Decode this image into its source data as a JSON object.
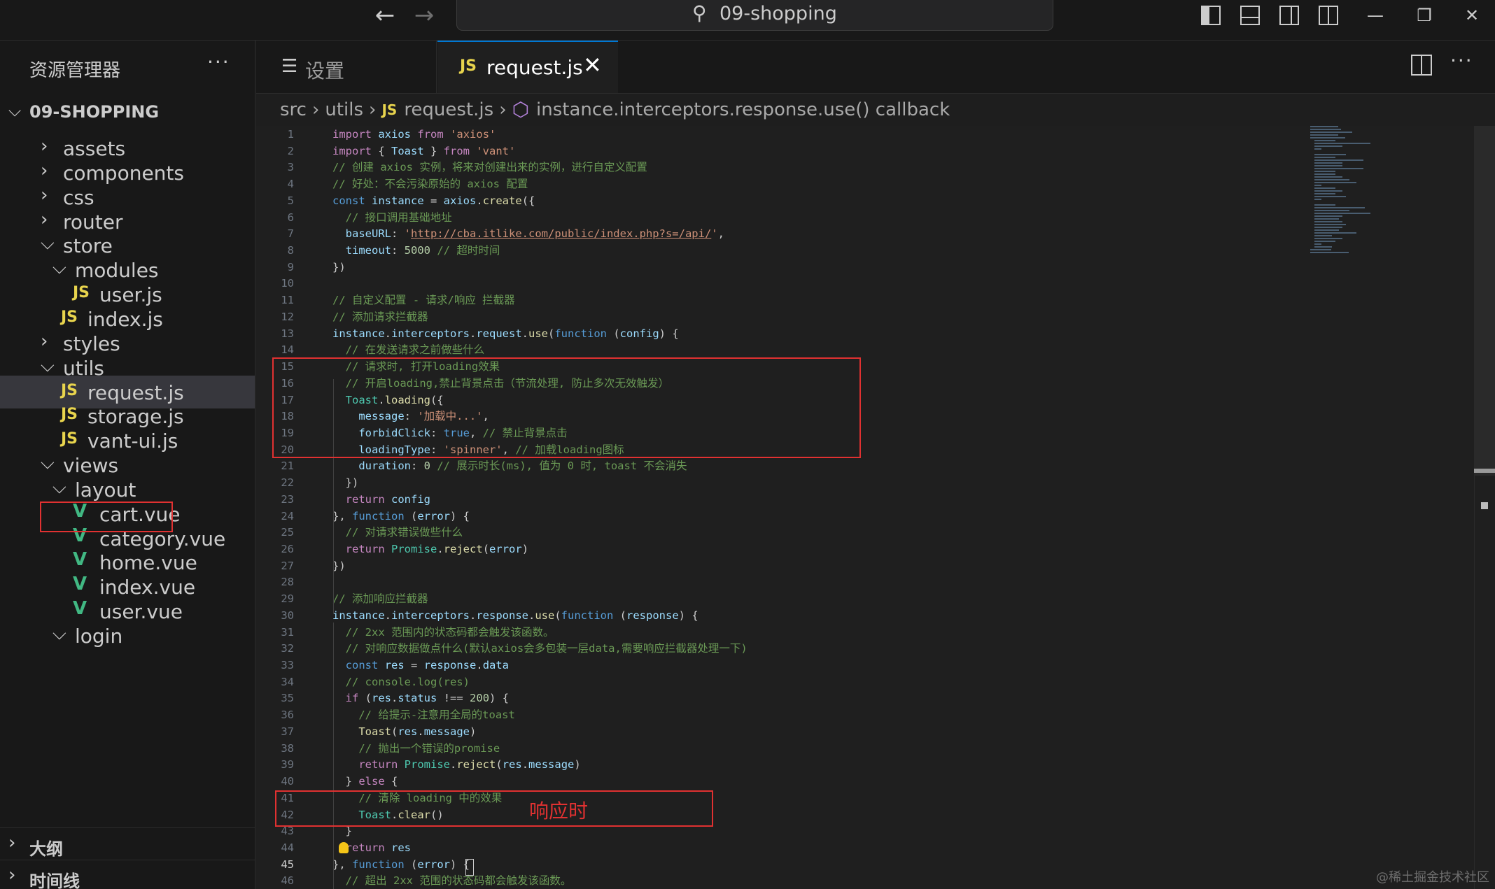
{
  "window": {
    "search_text": "09-shopping",
    "back_icon": "←",
    "forward_icon": "→",
    "minimize": "—",
    "restore": "❐",
    "close": "✕"
  },
  "sidebar": {
    "title": "资源管理器",
    "more": "···",
    "root": "09-SHOPPING",
    "items": [
      {
        "label": "assets",
        "type": "folder",
        "expanded": false
      },
      {
        "label": "components",
        "type": "folder",
        "expanded": false
      },
      {
        "label": "css",
        "type": "folder",
        "expanded": false
      },
      {
        "label": "router",
        "type": "folder",
        "expanded": false
      },
      {
        "label": "store",
        "type": "folder",
        "expanded": true
      },
      {
        "label": "modules",
        "type": "folder",
        "expanded": true
      },
      {
        "label": "user.js",
        "type": "js"
      },
      {
        "label": "index.js",
        "type": "js"
      },
      {
        "label": "styles",
        "type": "folder",
        "expanded": false
      },
      {
        "label": "utils",
        "type": "folder",
        "expanded": true
      },
      {
        "label": "request.js",
        "type": "js",
        "selected": true
      },
      {
        "label": "storage.js",
        "type": "js"
      },
      {
        "label": "vant-ui.js",
        "type": "js"
      },
      {
        "label": "views",
        "type": "folder",
        "expanded": true
      },
      {
        "label": "layout",
        "type": "folder",
        "expanded": true
      },
      {
        "label": "cart.vue",
        "type": "vue"
      },
      {
        "label": "category.vue",
        "type": "vue"
      },
      {
        "label": "home.vue",
        "type": "vue"
      },
      {
        "label": "index.vue",
        "type": "vue"
      },
      {
        "label": "user.vue",
        "type": "vue"
      },
      {
        "label": "login",
        "type": "folder",
        "expanded": true
      }
    ],
    "outline": "大纲",
    "timeline": "时间线"
  },
  "tabs": {
    "settings_label": "设置",
    "active_label": "request.js",
    "js_badge": "JS"
  },
  "breadcrumb": {
    "src": "src",
    "utils": "utils",
    "file": "request.js",
    "symbol": "instance.interceptors.response.use() callback"
  },
  "annotation": {
    "label": "响应时"
  },
  "watermark": "@稀土掘金技术社区",
  "code_lines": [
    {
      "n": "1",
      "html": "<span class='kw2'>import</span> <span class='var'>axios</span> <span class='kw2'>from</span> <span class='str'>'axios'</span>"
    },
    {
      "n": "2",
      "html": "<span class='kw2'>import</span> { <span class='var'>Toast</span> } <span class='kw2'>from</span> <span class='str'>'vant'</span>"
    },
    {
      "n": "3",
      "html": "<span class='cm'>// 创建 axios 实例，将来对创建出来的实例，进行自定义配置</span>"
    },
    {
      "n": "4",
      "html": "<span class='cm'>// 好处：不会污染原始的 axios 配置</span>"
    },
    {
      "n": "5",
      "html": "<span class='kw'>const</span> <span class='var'>instance</span> = <span class='var'>axios</span>.<span class='fn'>create</span>({"
    },
    {
      "n": "6",
      "html": "  <span class='cm'>// 接口调用基础地址</span>"
    },
    {
      "n": "7",
      "html": "  <span class='var'>baseURL</span>: <span class='str'>'</span><span class='url'>http://cba.itlike.com/public/index.php?s=/api/</span><span class='str'>'</span>,"
    },
    {
      "n": "8",
      "html": "  <span class='var'>timeout</span>: <span class='num'>5000</span> <span class='cm'>// 超时时间</span>"
    },
    {
      "n": "9",
      "html": "})"
    },
    {
      "n": "10",
      "html": ""
    },
    {
      "n": "11",
      "html": "<span class='cm'>// 自定义配置 - 请求/响应 拦截器</span>"
    },
    {
      "n": "12",
      "html": "<span class='cm'>// 添加请求拦截器</span>"
    },
    {
      "n": "13",
      "html": "<span class='var'>instance</span>.<span class='var'>interceptors</span>.<span class='var'>request</span>.<span class='fn'>use</span>(<span class='kw'>function</span> (<span class='var'>config</span>) {"
    },
    {
      "n": "14",
      "html": "  <span class='cm'>// 在发送请求之前做些什么</span>"
    },
    {
      "n": "15",
      "html": "  <span class='cm'>// 请求时, 打开loading效果</span>"
    },
    {
      "n": "16",
      "html": "  <span class='cm'>// 开启loading,禁止背景点击（节流处理, 防止多次无效触发）</span>"
    },
    {
      "n": "17",
      "html": "  <span class='cls'>Toast</span>.<span class='fn'>loading</span>({"
    },
    {
      "n": "18",
      "html": "    <span class='var'>message</span>: <span class='str'>'加载中...'</span>,"
    },
    {
      "n": "19",
      "html": "    <span class='var'>forbidClick</span>: <span class='kw'>true</span>, <span class='cm'>// 禁止背景点击</span>"
    },
    {
      "n": "20",
      "html": "    <span class='var'>loadingType</span>: <span class='str'>'spinner'</span>, <span class='cm'>// 加载loading图标</span>"
    },
    {
      "n": "21",
      "html": "    <span class='var'>duration</span>: <span class='num'>0</span> <span class='cm'>// 展示时长(ms), 值为 0 时, toast 不会消失</span>"
    },
    {
      "n": "22",
      "html": "  })"
    },
    {
      "n": "23",
      "html": "  <span class='kw2'>return</span> <span class='var'>config</span>"
    },
    {
      "n": "24",
      "html": "}, <span class='kw'>function</span> (<span class='var'>error</span>) {"
    },
    {
      "n": "25",
      "html": "  <span class='cm'>// 对请求错误做些什么</span>"
    },
    {
      "n": "26",
      "html": "  <span class='kw2'>return</span> <span class='cls'>Promise</span>.<span class='fn'>reject</span>(<span class='var'>error</span>)"
    },
    {
      "n": "27",
      "html": "})"
    },
    {
      "n": "28",
      "html": ""
    },
    {
      "n": "29",
      "html": "<span class='cm'>// 添加响应拦截器</span>"
    },
    {
      "n": "30",
      "html": "<span class='var'>instance</span>.<span class='var'>interceptors</span>.<span class='var'>response</span>.<span class='fn'>use</span>(<span class='kw'>function</span> (<span class='var'>response</span>) {"
    },
    {
      "n": "31",
      "html": "  <span class='cm'>// 2xx 范围内的状态码都会触发该函数。</span>"
    },
    {
      "n": "32",
      "html": "  <span class='cm'>// 对响应数据做点什么(默认axios会多包装一层data,需要响应拦截器处理一下)</span>"
    },
    {
      "n": "33",
      "html": "  <span class='kw'>const</span> <span class='var'>res</span> = <span class='var'>response</span>.<span class='var'>data</span>"
    },
    {
      "n": "34",
      "html": "  <span class='cm'>// console.log(res)</span>"
    },
    {
      "n": "35",
      "html": "  <span class='kw2'>if</span> (<span class='var'>res</span>.<span class='var'>status</span> !== <span class='num'>200</span>) {"
    },
    {
      "n": "36",
      "html": "    <span class='cm'>// 给提示-注意用全局的toast</span>"
    },
    {
      "n": "37",
      "html": "    <span class='fn'>Toast</span>(<span class='var'>res</span>.<span class='var'>message</span>)"
    },
    {
      "n": "38",
      "html": "    <span class='cm'>// 抛出一个错误的promise</span>"
    },
    {
      "n": "39",
      "html": "    <span class='kw2'>return</span> <span class='cls'>Promise</span>.<span class='fn'>reject</span>(<span class='var'>res</span>.<span class='var'>message</span>)"
    },
    {
      "n": "40",
      "html": "  } <span class='kw2'>else</span> {"
    },
    {
      "n": "41",
      "html": "    <span class='cm'>// 清除 loading 中的效果</span>"
    },
    {
      "n": "42",
      "html": "    <span class='cls'>Toast</span>.<span class='fn'>clear</span>()"
    },
    {
      "n": "43",
      "html": "  }"
    },
    {
      "n": "44",
      "html": "  <span class='kw2'>return</span> <span class='var'>res</span>"
    },
    {
      "n": "45",
      "html": "}, <span class='kw'>function</span> (<span class='var'>error</span>) {"
    },
    {
      "n": "46",
      "html": "  <span class='cm'>// 超出 2xx 范围的状态码都会触发该函数。</span>"
    }
  ]
}
